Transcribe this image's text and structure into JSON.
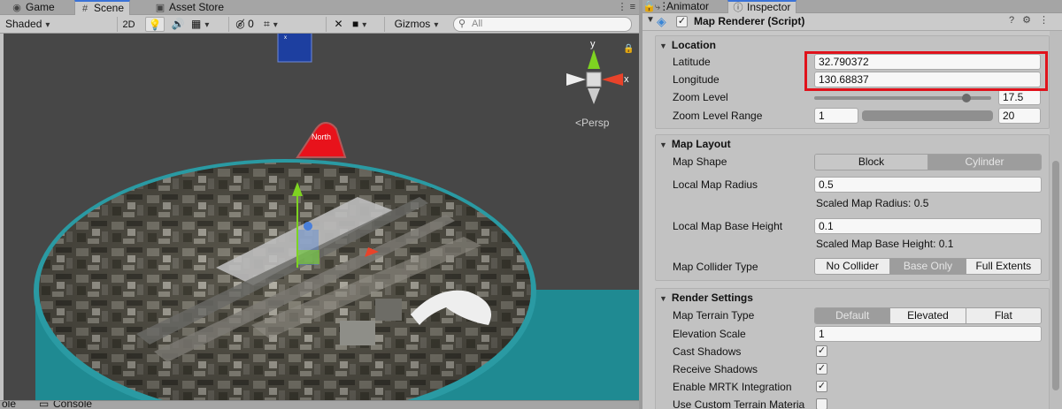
{
  "left_tabs": [
    {
      "label": "Game",
      "icon": "gamepad-icon"
    },
    {
      "label": "Scene",
      "icon": "hash-grid-icon"
    },
    {
      "label": "Asset Store",
      "icon": "shopping-bag-icon"
    }
  ],
  "scene_toolbar": {
    "draw_mode": "Shaded",
    "mode_2d": "2D",
    "hidden_count": "0",
    "gizmos": "Gizmos",
    "search_placeholder": "All"
  },
  "scene_view": {
    "gizmo_x": "x",
    "gizmo_y": "y",
    "projection": "Persp",
    "north_label": "North"
  },
  "bottom_tabs": {
    "left_label": "ole",
    "console": "Console"
  },
  "right_tabs": [
    {
      "label": "Animator",
      "icon": "animator-icon"
    },
    {
      "label": "Inspector",
      "icon": "info-icon"
    }
  ],
  "component": {
    "title": "Map Renderer (Script)",
    "enabled": true
  },
  "location": {
    "header": "Location",
    "latitude_label": "Latitude",
    "latitude_value": "32.790372",
    "longitude_label": "Longitude",
    "longitude_value": "130.68837",
    "zoom_label": "Zoom Level",
    "zoom_value": "17.5",
    "zoom_fraction": 0.86,
    "zoom_range_label": "Zoom Level Range",
    "zoom_range_min": "1",
    "zoom_range_max": "20"
  },
  "map_layout": {
    "header": "Map Layout",
    "shape_label": "Map Shape",
    "shape_options": [
      "Block",
      "Cylinder"
    ],
    "shape_selected": "Block",
    "radius_label": "Local Map Radius",
    "radius_value": "0.5",
    "scaled_radius": "Scaled Map Radius: 0.5",
    "base_height_label": "Local Map Base Height",
    "base_height_value": "0.1",
    "scaled_base_height": "Scaled Map Base Height: 0.1",
    "collider_label": "Map Collider Type",
    "collider_options": [
      "No Collider",
      "Base Only",
      "Full Extents"
    ],
    "collider_selected": "Base Only"
  },
  "render_settings": {
    "header": "Render Settings",
    "terrain_type_label": "Map Terrain Type",
    "terrain_options": [
      "Default",
      "Elevated",
      "Flat"
    ],
    "terrain_selected": "Default",
    "elevation_scale_label": "Elevation Scale",
    "elevation_scale_value": "1",
    "cast_shadows_label": "Cast Shadows",
    "cast_shadows": true,
    "receive_shadows_label": "Receive Shadows",
    "receive_shadows": true,
    "mrtk_label": "Enable MRTK Integration",
    "mrtk": true,
    "custom_terrain_label": "Use Custom Terrain Materia",
    "custom_terrain": false
  },
  "colors": {
    "highlight": "#e0121b",
    "north_marker": "#e8121b",
    "map_rim": "#2a9aa3",
    "gizmo_y": "#7ed321",
    "gizmo_x": "#e8432a"
  }
}
